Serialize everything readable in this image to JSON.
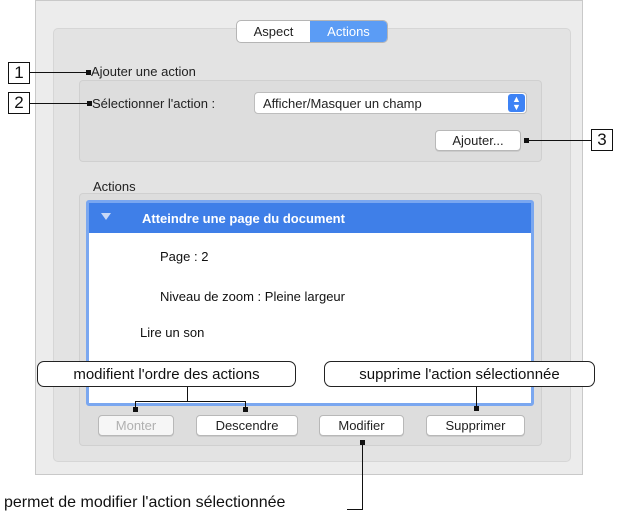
{
  "tabs": {
    "aspect": "Aspect",
    "actions": "Actions"
  },
  "add_action": {
    "section_label": "Ajouter une action",
    "select_label": "Sélectionner l'action :",
    "selected_value": "Afficher/Masquer un champ",
    "add_button": "Ajouter..."
  },
  "actions_section": {
    "title": "Actions",
    "items": [
      {
        "label": "Atteindre une page du document",
        "selected": true
      },
      {
        "label": "Page : 2"
      },
      {
        "label": "Niveau de zoom : Pleine largeur"
      },
      {
        "label": "Lire un son"
      }
    ],
    "buttons": {
      "up": "Monter",
      "down": "Descendre",
      "edit": "Modifier",
      "delete": "Supprimer"
    }
  },
  "annotations": {
    "num1": "1",
    "num2": "2",
    "num3": "3",
    "order": "modifient l'ordre des actions",
    "delete": "supprime l'action sélectionnée",
    "edit": "permet de modifier l'action sélectionnée"
  },
  "colors": {
    "accent": "#3f7fe8",
    "list_border": "#7aa7f0"
  }
}
